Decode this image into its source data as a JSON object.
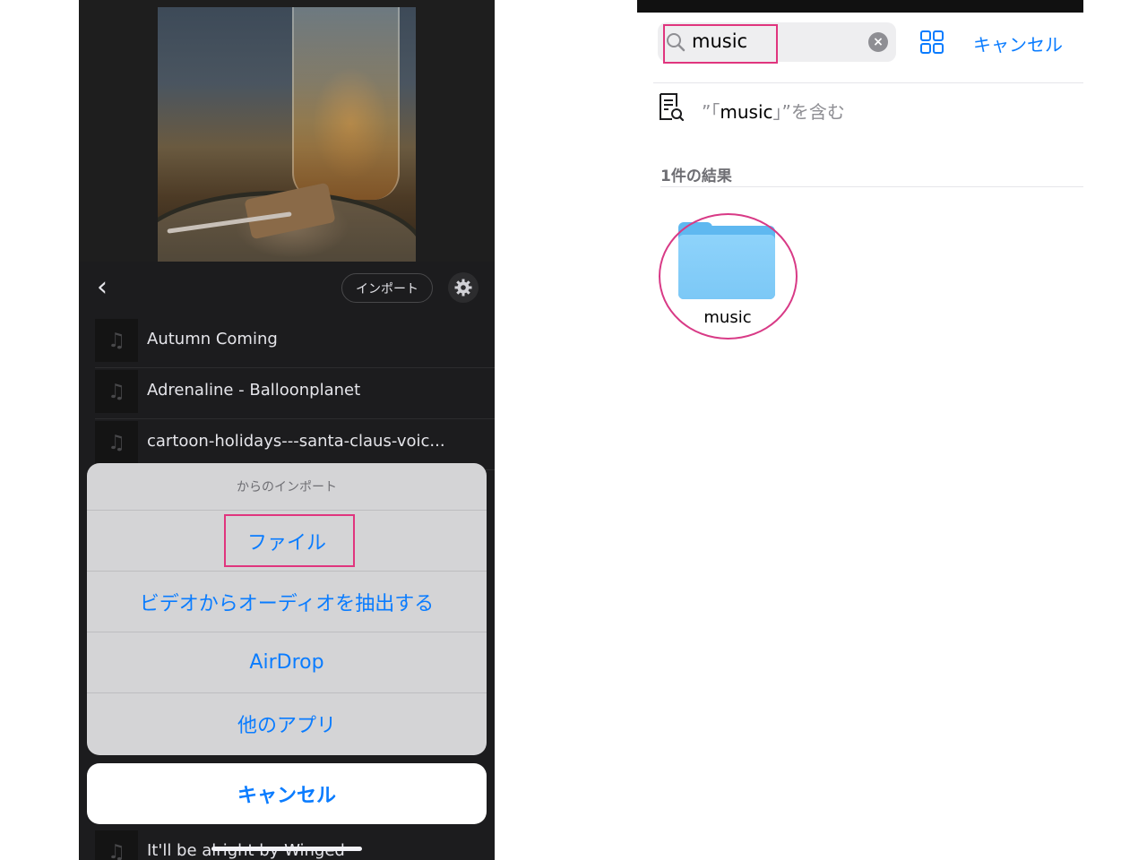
{
  "left": {
    "toolbar": {
      "import_label": "インポート"
    },
    "tracks": [
      "Autumn Coming",
      "Adrenaline - Balloonplanet",
      "cartoon-holidays---santa-claus-voic...",
      "It'll be alright by Winged"
    ],
    "action_sheet": {
      "header": "からのインポート",
      "options": [
        "ファイル",
        "ビデオからオーディオを抽出する",
        "AirDrop",
        "他のアプリ"
      ],
      "cancel_label": "キャンセル"
    }
  },
  "right": {
    "search": {
      "value": "music"
    },
    "cancel_label": "キャンセル",
    "suggestion": {
      "prefix": "”「",
      "term": "music",
      "suffix": "」”を含む"
    },
    "results_header": "1件の結果",
    "results": [
      {
        "name": "music",
        "type": "folder"
      }
    ]
  },
  "colors": {
    "accent": "#0a7cff",
    "highlight": "#e0357e",
    "folder": "#7cc8f6"
  }
}
